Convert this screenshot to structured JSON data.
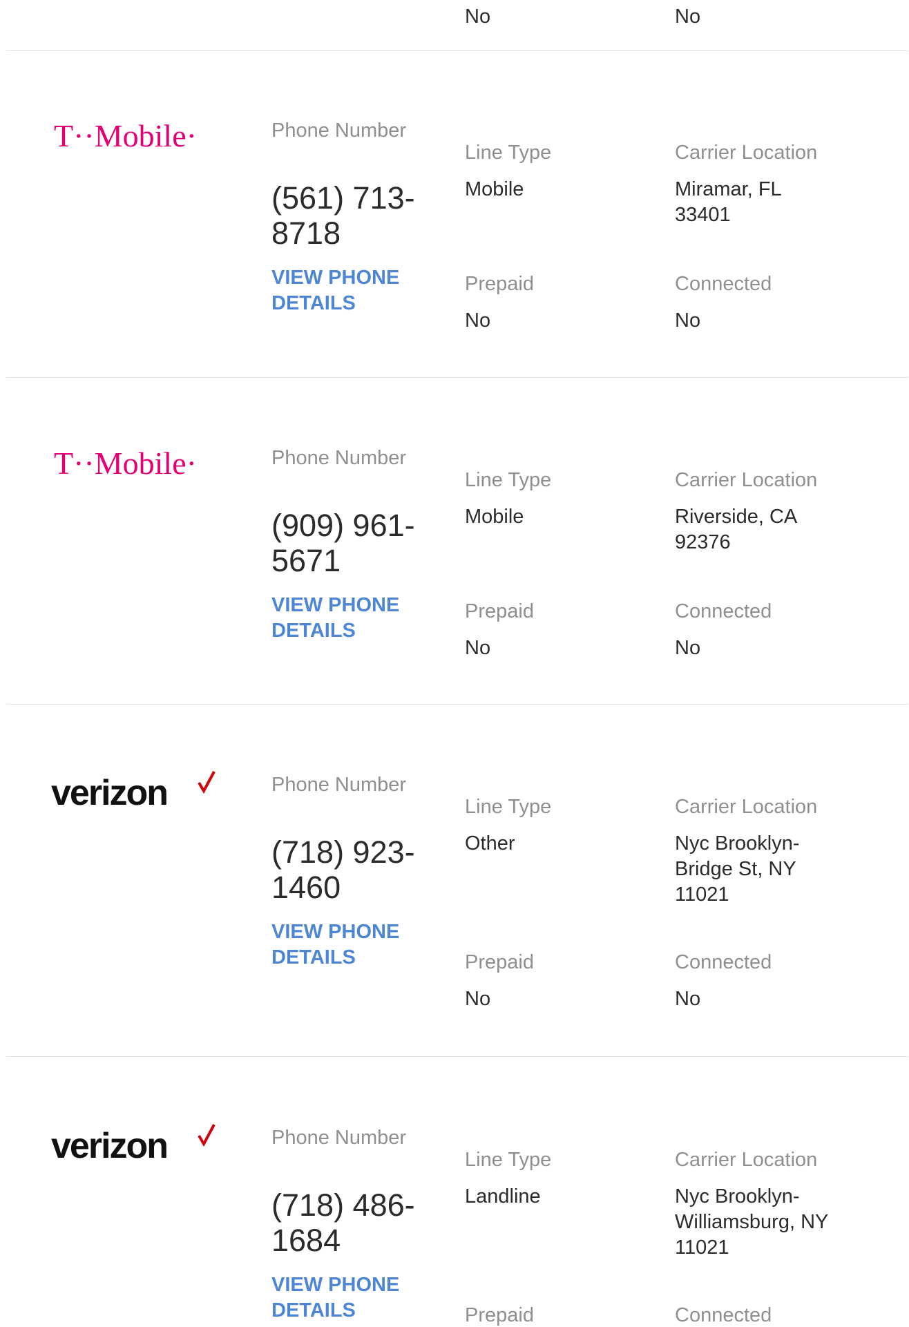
{
  "top_partial": {
    "prepaid_value": "No",
    "connected_value": "No"
  },
  "labels": {
    "phone_number": "Phone Number",
    "line_type": "Line Type",
    "carrier_location": "Carrier Location",
    "prepaid": "Prepaid",
    "connected": "Connected",
    "view_details": "VIEW PHONE DETAILS"
  },
  "records": [
    {
      "carrier": "T-Mobile",
      "logo_text": "T··Mobile·",
      "phone": "(561) 713-8718",
      "line_type": "Mobile",
      "carrier_location": "Miramar, FL 33401",
      "prepaid": "No",
      "connected": "No"
    },
    {
      "carrier": "T-Mobile",
      "logo_text": "T··Mobile·",
      "phone": "(909) 961-5671",
      "line_type": "Mobile",
      "carrier_location": "Riverside, CA 92376",
      "prepaid": "No",
      "connected": "No"
    },
    {
      "carrier": "Verizon",
      "logo_text": "verizon",
      "phone": "(718) 923-1460",
      "line_type": "Other",
      "carrier_location": "Nyc Brooklyn-Bridge St, NY 11021",
      "prepaid": "No",
      "connected": "No"
    },
    {
      "carrier": "Verizon",
      "logo_text": "verizon",
      "phone": "(718) 486-1684",
      "line_type": "Landline",
      "carrier_location": "Nyc Brooklyn-Williamsburg, NY 11021",
      "prepaid": "",
      "connected": ""
    }
  ],
  "colors": {
    "tmobile_magenta": "#e20074",
    "verizon_red": "#cd040b",
    "link_blue": "#4f86d4",
    "label_gray": "#8f8f8f"
  }
}
